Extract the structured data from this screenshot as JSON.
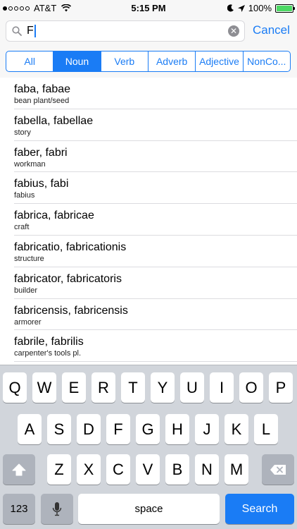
{
  "status_bar": {
    "carrier": "AT&T",
    "time": "5:15 PM",
    "battery": "100%",
    "signal_dots": 1
  },
  "search": {
    "value": "F"
  },
  "cancel_label": "Cancel",
  "segments": [
    {
      "label": "All",
      "active": false
    },
    {
      "label": "Noun",
      "active": true
    },
    {
      "label": "Verb",
      "active": false
    },
    {
      "label": "Adverb",
      "active": false
    },
    {
      "label": "Adjective",
      "active": false
    },
    {
      "label": "NonCo...",
      "active": false
    }
  ],
  "results": [
    {
      "term": "faba, fabae",
      "definition": "bean plant/seed"
    },
    {
      "term": "fabella, fabellae",
      "definition": "story"
    },
    {
      "term": "faber, fabri",
      "definition": "workman"
    },
    {
      "term": "fabius, fabi",
      "definition": "fabius"
    },
    {
      "term": "fabrica, fabricae",
      "definition": "craft"
    },
    {
      "term": "fabricatio, fabricationis",
      "definition": "structure"
    },
    {
      "term": "fabricator, fabricatoris",
      "definition": "builder"
    },
    {
      "term": "fabricensis, fabricensis",
      "definition": "armorer"
    },
    {
      "term": "fabrile, fabrilis",
      "definition": "carpenter's tools pl."
    }
  ],
  "keyboard": {
    "row1": [
      "Q",
      "W",
      "E",
      "R",
      "T",
      "Y",
      "U",
      "I",
      "O",
      "P"
    ],
    "row2": [
      "A",
      "S",
      "D",
      "F",
      "G",
      "H",
      "J",
      "K",
      "L"
    ],
    "row3": [
      "Z",
      "X",
      "C",
      "V",
      "B",
      "N",
      "M"
    ],
    "numbers_label": "123",
    "space_label": "space",
    "search_label": "Search"
  },
  "colors": {
    "accent": "#1a7cf5",
    "battery": "#4cd964"
  }
}
